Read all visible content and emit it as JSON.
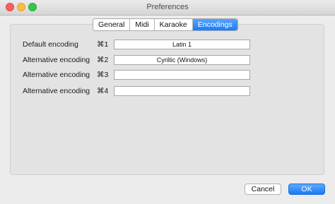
{
  "window": {
    "title": "Preferences"
  },
  "tabs": [
    {
      "label": "General",
      "active": false
    },
    {
      "label": "Midi",
      "active": false
    },
    {
      "label": "Karaoke",
      "active": false
    },
    {
      "label": "Encodings",
      "active": true
    }
  ],
  "encodings": [
    {
      "label": "Default encoding",
      "shortcut": "⌘1",
      "value": "Latin 1"
    },
    {
      "label": "Alternative encoding",
      "shortcut": "⌘2",
      "value": "Cyrillic (Windows)"
    },
    {
      "label": "Alternative encoding",
      "shortcut": "⌘3",
      "value": ""
    },
    {
      "label": "Alternative encoding",
      "shortcut": "⌘4",
      "value": ""
    }
  ],
  "buttons": {
    "cancel": "Cancel",
    "ok": "OK"
  },
  "colors": {
    "accent": "#1b7cf4",
    "close": "#fc605c",
    "minimize": "#fdbc40",
    "zoom": "#34c84a"
  }
}
